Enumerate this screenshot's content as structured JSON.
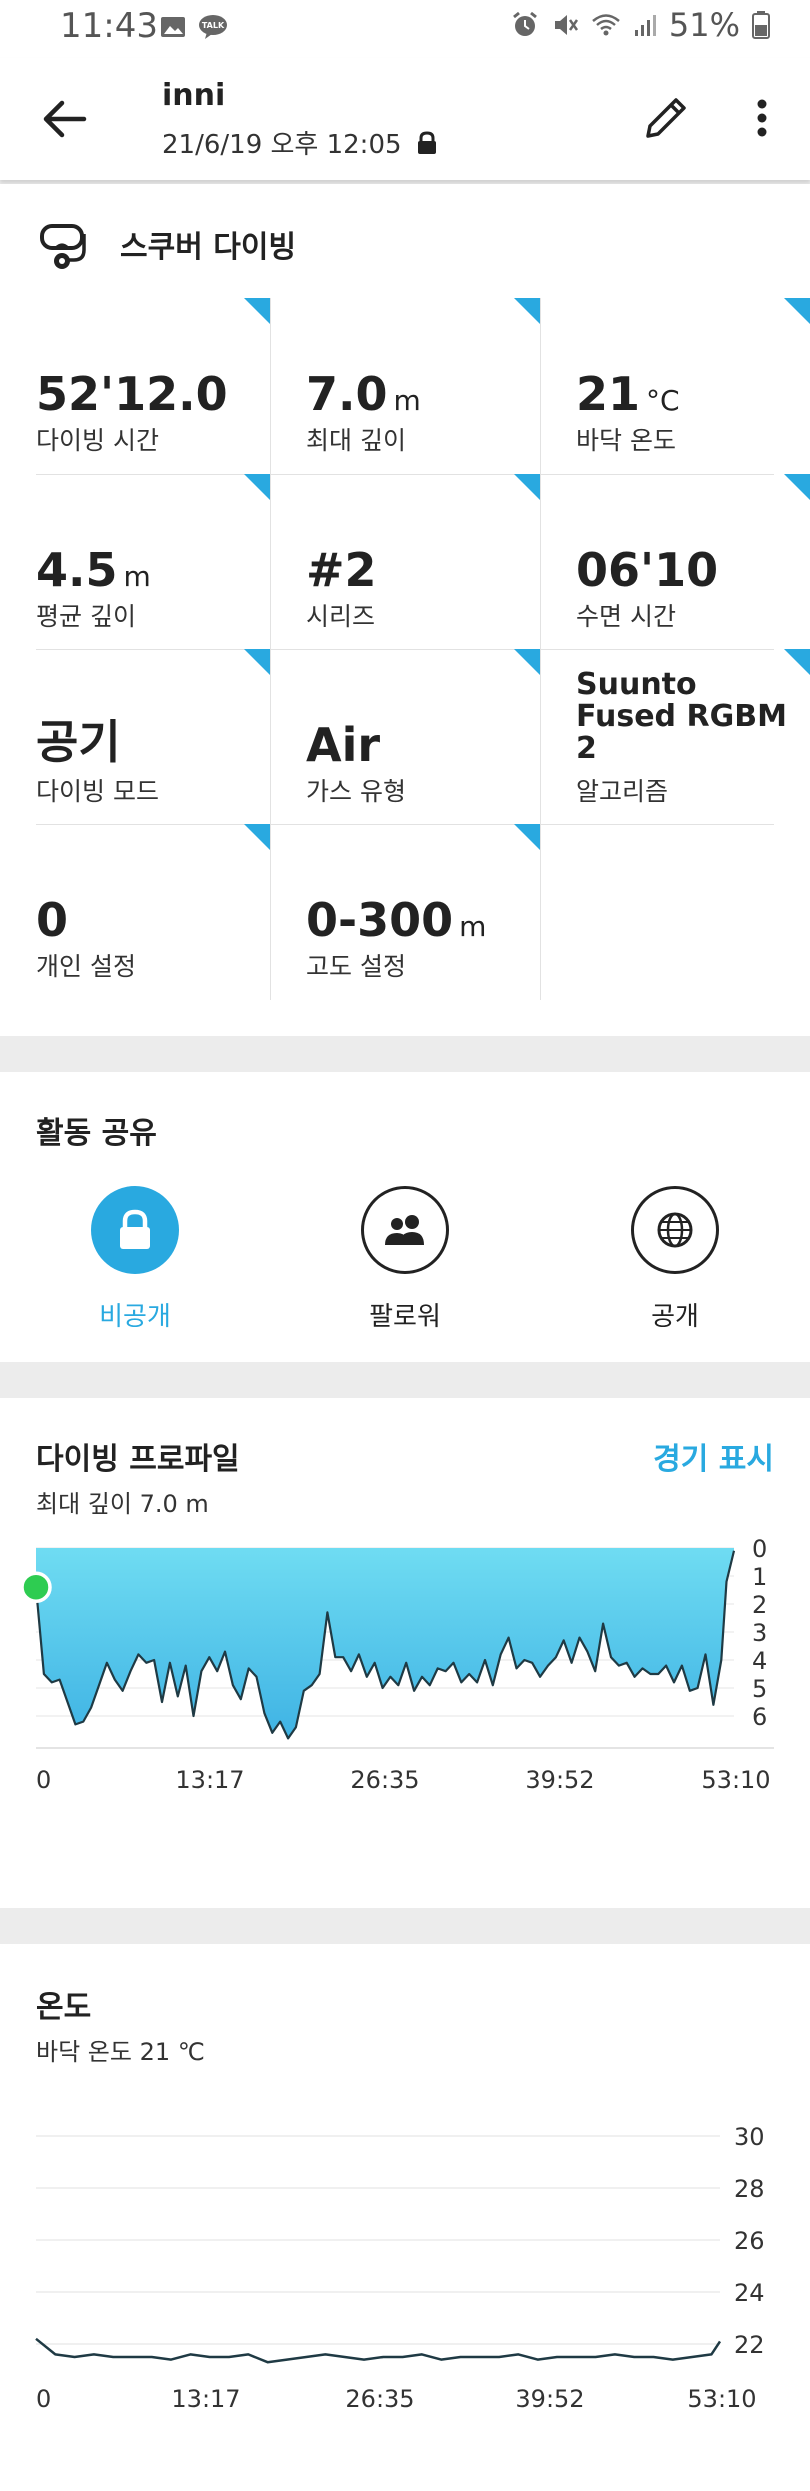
{
  "status_bar": {
    "time": "11:43",
    "battery": "51%",
    "icons_left": [
      "gallery-icon",
      "kakaotalk-icon"
    ],
    "icons_right": [
      "alarm-icon",
      "mute-icon",
      "wifi-icon",
      "signal-icon",
      "battery-icon"
    ]
  },
  "header": {
    "title": "inni",
    "subtitle": "21/6/19 오후 12:05"
  },
  "activity": {
    "type_label": "스쿠버 다이빙"
  },
  "stats": [
    {
      "value": "52'12.0",
      "unit": "",
      "label": "다이빙 시간"
    },
    {
      "value": "7.0",
      "unit": "m",
      "label": "최대 깊이"
    },
    {
      "value": "21",
      "unit": "°C",
      "label": "바닥 온도"
    },
    {
      "value": "4.5",
      "unit": "m",
      "label": "평균 깊이"
    },
    {
      "value": "#2",
      "unit": "",
      "label": "시리즈"
    },
    {
      "value": "06'10",
      "unit": "",
      "label": "수면 시간"
    },
    {
      "value": "공기",
      "unit": "",
      "label": "다이빙 모드"
    },
    {
      "value": "Air",
      "unit": "",
      "label": "가스 유형"
    },
    {
      "value": "Suunto Fused RGBM 2",
      "unit": "",
      "label": "알고리즘"
    },
    {
      "value": "0",
      "unit": "",
      "label": "개인 설정"
    },
    {
      "value": "0-300",
      "unit": "m",
      "label": "고도 설정"
    }
  ],
  "share": {
    "title": "활동 공유",
    "options": [
      {
        "label": "비공개",
        "icon": "lock-icon",
        "selected": true
      },
      {
        "label": "팔로워",
        "icon": "followers-icon",
        "selected": false
      },
      {
        "label": "공개",
        "icon": "globe-icon",
        "selected": false
      }
    ]
  },
  "profile": {
    "title": "다이빙 프로파일",
    "subtitle": "최대 깊이 7.0 m",
    "race_link": "경기 표시"
  },
  "temperature": {
    "title": "온도",
    "subtitle": "바닥 온도 21 ℃"
  },
  "colors": {
    "accent": "#29a9e0",
    "depth_fill_top": "#6fdcf2",
    "depth_fill_bottom": "#3fb3e4",
    "start_marker": "#2ecc51"
  },
  "chart_data": [
    {
      "type": "area",
      "x": [
        0.0,
        0.6,
        1.2,
        1.8,
        2.4,
        3.0,
        3.6,
        4.2,
        4.8,
        5.4,
        6.0,
        6.6,
        7.2,
        7.8,
        8.4,
        9.0,
        9.6,
        10.2,
        10.8,
        11.4,
        12.0,
        12.6,
        13.2,
        13.8,
        14.4,
        15.0,
        15.6,
        16.2,
        16.8,
        17.4,
        18.0,
        18.6,
        19.2,
        19.8,
        20.4,
        21.0,
        21.6,
        22.2,
        22.8,
        23.4,
        24.0,
        24.6,
        25.2,
        25.8,
        26.4,
        27.0,
        27.6,
        28.2,
        28.8,
        29.4,
        30.0,
        30.6,
        31.2,
        31.8,
        32.4,
        33.0,
        33.6,
        34.2,
        34.8,
        35.4,
        36.0,
        36.6,
        37.2,
        37.8,
        38.4,
        39.0,
        39.6,
        40.2,
        40.8,
        41.4,
        42.0,
        42.6,
        43.2,
        43.8,
        44.4,
        45.0,
        45.6,
        46.2,
        46.8,
        47.4,
        48.0,
        48.6,
        49.2,
        49.8,
        50.4,
        51.0,
        51.6,
        52.2,
        52.6,
        53.17
      ],
      "y": [
        1.4,
        4.5,
        4.8,
        4.7,
        5.5,
        6.3,
        6.2,
        5.7,
        4.9,
        4.1,
        4.7,
        5.1,
        4.4,
        3.8,
        4.1,
        4.0,
        5.5,
        4.1,
        5.3,
        4.2,
        6.0,
        4.4,
        3.9,
        4.4,
        3.7,
        4.9,
        5.4,
        4.3,
        4.6,
        5.9,
        6.6,
        6.2,
        6.8,
        6.4,
        5.1,
        4.9,
        4.5,
        2.3,
        3.9,
        3.9,
        4.4,
        3.8,
        4.6,
        4.1,
        5.0,
        4.6,
        4.9,
        4.1,
        5.1,
        4.6,
        4.9,
        4.3,
        4.4,
        4.1,
        4.8,
        4.5,
        4.8,
        4.0,
        4.9,
        3.8,
        3.2,
        4.3,
        4.0,
        4.1,
        4.6,
        4.2,
        3.9,
        3.3,
        4.1,
        3.2,
        3.7,
        4.4,
        2.7,
        3.9,
        4.2,
        4.1,
        4.6,
        4.3,
        4.5,
        4.5,
        4.2,
        4.8,
        4.2,
        5.1,
        5.0,
        3.8,
        5.6,
        4.0,
        1.2,
        0.1
      ],
      "xtick_labels": [
        "0",
        "13:17",
        "26:35",
        "39:52",
        "53:10"
      ],
      "y_axis_ticks": [
        "0",
        "1",
        "2",
        "3",
        "4",
        "5",
        "6"
      ],
      "ylim": [
        0,
        7
      ],
      "y_inverted": true,
      "unit": "m",
      "grid": true
    },
    {
      "type": "line",
      "x": [
        0.0,
        1.5,
        3.0,
        4.5,
        6.0,
        7.5,
        9.0,
        10.5,
        12.0,
        13.5,
        15.0,
        16.5,
        18.0,
        19.5,
        21.0,
        22.5,
        24.0,
        25.5,
        27.0,
        28.5,
        30.0,
        31.5,
        33.0,
        34.5,
        36.0,
        37.5,
        39.0,
        40.5,
        42.0,
        43.5,
        45.0,
        46.5,
        48.0,
        49.5,
        51.0,
        52.5,
        53.17
      ],
      "y": [
        22.2,
        21.6,
        21.5,
        21.6,
        21.5,
        21.5,
        21.5,
        21.4,
        21.6,
        21.5,
        21.5,
        21.6,
        21.3,
        21.4,
        21.5,
        21.6,
        21.5,
        21.4,
        21.5,
        21.5,
        21.6,
        21.4,
        21.5,
        21.5,
        21.5,
        21.6,
        21.4,
        21.5,
        21.5,
        21.5,
        21.6,
        21.5,
        21.5,
        21.4,
        21.5,
        21.6,
        22.1
      ],
      "xtick_labels": [
        "0",
        "13:17",
        "26:35",
        "39:52",
        "53:10"
      ],
      "y_axis_ticks": [
        "30",
        "28",
        "26",
        "24",
        "22"
      ],
      "ylim": [
        21,
        31
      ],
      "unit": "°C",
      "grid": true
    }
  ]
}
